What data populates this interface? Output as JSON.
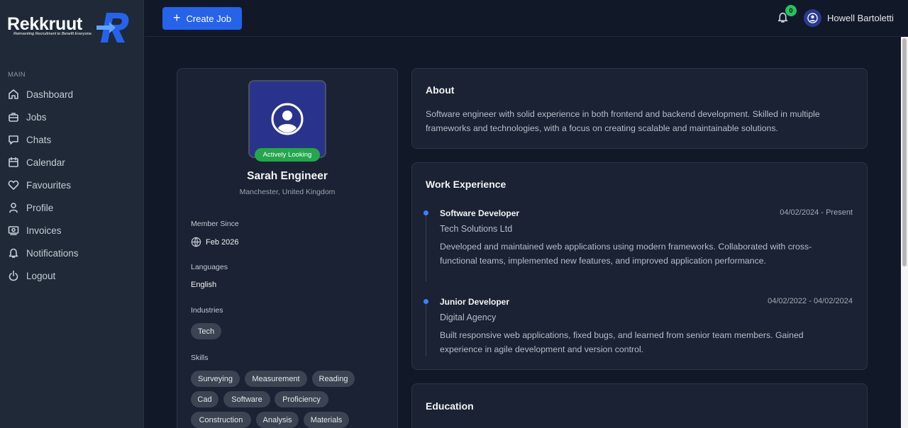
{
  "brand": {
    "name": "Rekkruut",
    "tagline": "Reinventing Recruitment to Benefit Everyone.",
    "accent": "#2563eb"
  },
  "sidebar": {
    "section": "MAIN",
    "items": [
      {
        "label": "Dashboard",
        "icon": "home-icon"
      },
      {
        "label": "Jobs",
        "icon": "briefcase-icon"
      },
      {
        "label": "Chats",
        "icon": "chat-icon"
      },
      {
        "label": "Calendar",
        "icon": "calendar-icon"
      },
      {
        "label": "Favourites",
        "icon": "heart-icon"
      },
      {
        "label": "Profile",
        "icon": "user-icon"
      },
      {
        "label": "Invoices",
        "icon": "invoice-icon"
      },
      {
        "label": "Notifications",
        "icon": "bell-icon"
      },
      {
        "label": "Logout",
        "icon": "logout-icon"
      }
    ]
  },
  "topbar": {
    "create_label": "Create Job",
    "notification_count": "0",
    "user_name": "Howell Bartoletti"
  },
  "profile": {
    "status": "Actively Looking",
    "name": "Sarah Engineer",
    "location": "Manchester, United Kingdom",
    "member_since_label": "Member Since",
    "member_since": "Feb 2026",
    "languages_label": "Languages",
    "languages": "English",
    "industries_label": "Industries",
    "industries": [
      "Tech"
    ],
    "skills_label": "Skills",
    "skills": [
      "Surveying",
      "Measurement",
      "Reading",
      "Cad",
      "Software",
      "Proficiency",
      "Construction",
      "Analysis",
      "Materials"
    ]
  },
  "about": {
    "title": "About",
    "text": "Software engineer with solid experience in both frontend and backend development. Skilled in multiple frameworks and technologies, with a focus on creating scalable and maintainable solutions."
  },
  "work": {
    "title": "Work Experience",
    "jobs": [
      {
        "title": "Software Developer",
        "dates": "04/02/2024 - Present",
        "company": "Tech Solutions Ltd",
        "description": "Developed and maintained web applications using modern frameworks. Collaborated with cross-functional teams, implemented new features, and improved application performance."
      },
      {
        "title": "Junior Developer",
        "dates": "04/02/2022 - 04/02/2024",
        "company": "Digital Agency",
        "description": "Built responsive web applications, fixed bugs, and learned from senior team members. Gained experience in agile development and version control."
      }
    ]
  },
  "education": {
    "title": "Education"
  }
}
